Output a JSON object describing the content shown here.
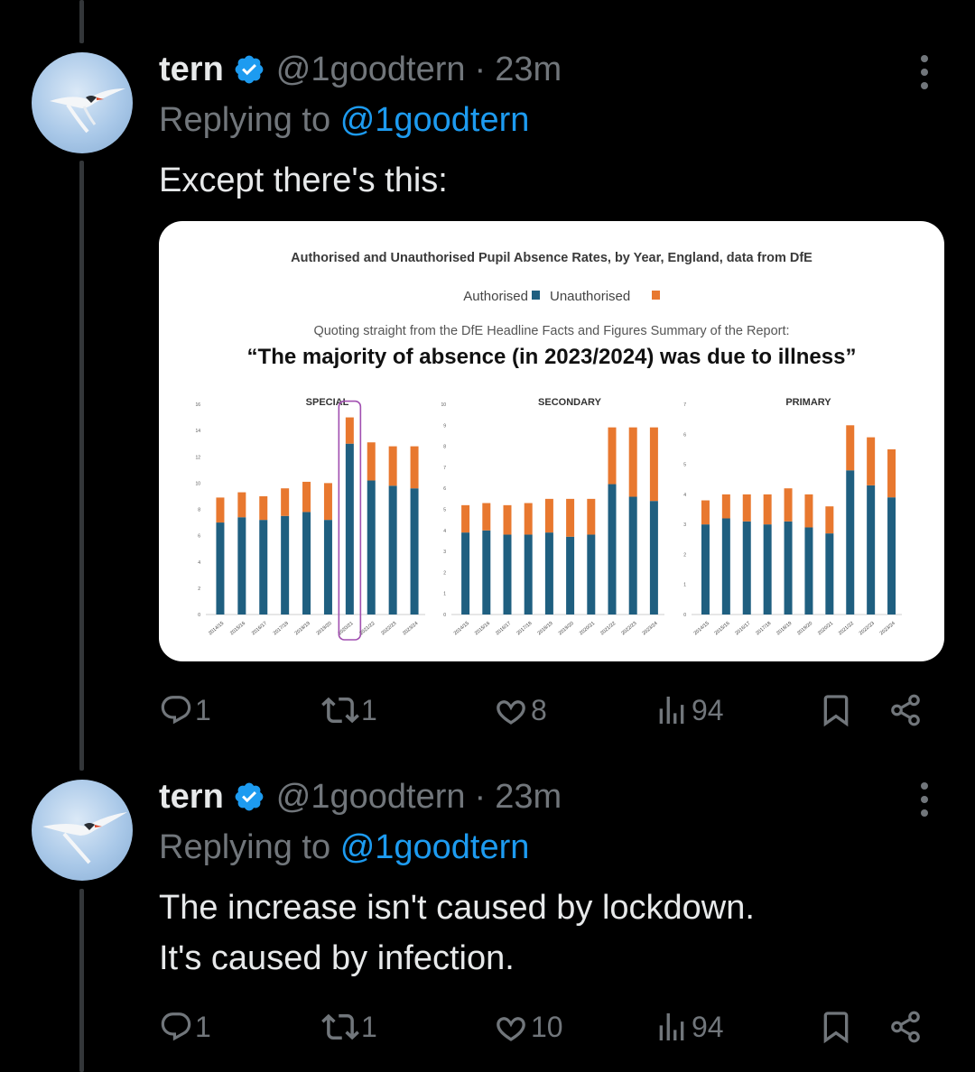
{
  "tweets": [
    {
      "name": "tern",
      "handle": "@1goodtern",
      "time": "23m",
      "replying_prefix": "Replying to",
      "replying_to": "@1goodtern",
      "text_lines": [
        "Except there's this:"
      ],
      "stats": {
        "replies": "1",
        "reposts": "1",
        "likes": "8",
        "views": "94"
      },
      "media": {
        "title": "Authorised and Unauthorised Pupil Absence Rates, by Year, England, data from DfE",
        "legend_authorised": "Authorised",
        "legend_unauthorised": "Unauthorised",
        "quote_intro": "Quoting straight from the DfE Headline Facts and Figures Summary of the Report:",
        "quote": "“The majority of absence (in 2023/2024) was due to illness”"
      }
    },
    {
      "name": "tern",
      "handle": "@1goodtern",
      "time": "23m",
      "replying_prefix": "Replying to",
      "replying_to": "@1goodtern",
      "text_lines": [
        "The increase isn't caused by lockdown.",
        "It's caused by infection."
      ],
      "stats": {
        "replies": "1",
        "reposts": "1",
        "likes": "10",
        "views": "94"
      }
    }
  ],
  "colors": {
    "authorised": "#1f5f80",
    "unauthorised": "#e8782f",
    "highlight": "#a14fb0",
    "mention": "#1d9bf0",
    "verified": "#1d9bf0"
  },
  "chart_data": [
    {
      "type": "bar",
      "title": "SPECIAL",
      "categories": [
        "2014/15",
        "2015/16",
        "2016/17",
        "2017/18",
        "2018/19",
        "2019/20",
        "2020/21",
        "2021/22",
        "2022/23",
        "2023/24"
      ],
      "series": [
        {
          "name": "Authorised",
          "values": [
            7.0,
            7.4,
            7.2,
            7.5,
            7.8,
            7.2,
            13.0,
            10.2,
            9.8,
            9.6
          ]
        },
        {
          "name": "Unauthorised",
          "values": [
            1.9,
            1.9,
            1.8,
            2.1,
            2.3,
            2.8,
            2.0,
            2.9,
            3.0,
            3.2
          ]
        }
      ],
      "ylim": [
        0,
        16
      ],
      "yticks": [
        0,
        2,
        4,
        6,
        8,
        10,
        12,
        14,
        16
      ],
      "highlight_category": "2020/21",
      "stacked": true
    },
    {
      "type": "bar",
      "title": "SECONDARY",
      "categories": [
        "2014/15",
        "2015/16",
        "2016/17",
        "2017/18",
        "2018/19",
        "2019/20",
        "2020/21",
        "2021/22",
        "2022/23",
        "2023/24"
      ],
      "series": [
        {
          "name": "Authorised",
          "values": [
            3.9,
            4.0,
            3.8,
            3.8,
            3.9,
            3.7,
            3.8,
            6.2,
            5.6,
            5.4
          ]
        },
        {
          "name": "Unauthorised",
          "values": [
            1.3,
            1.3,
            1.4,
            1.5,
            1.6,
            1.8,
            1.7,
            2.7,
            3.3,
            3.5
          ]
        }
      ],
      "ylim": [
        0,
        10
      ],
      "yticks": [
        0,
        1,
        2,
        3,
        4,
        5,
        6,
        7,
        8,
        9,
        10
      ],
      "stacked": true
    },
    {
      "type": "bar",
      "title": "PRIMARY",
      "categories": [
        "2014/15",
        "2015/16",
        "2016/17",
        "2017/18",
        "2018/19",
        "2019/20",
        "2020/21",
        "2021/22",
        "2022/23",
        "2023/24"
      ],
      "series": [
        {
          "name": "Authorised",
          "values": [
            3.0,
            3.2,
            3.1,
            3.0,
            3.1,
            2.9,
            2.7,
            4.8,
            4.3,
            3.9
          ]
        },
        {
          "name": "Unauthorised",
          "values": [
            0.8,
            0.8,
            0.9,
            1.0,
            1.1,
            1.1,
            0.9,
            1.5,
            1.6,
            1.6
          ]
        }
      ],
      "ylim": [
        0,
        7
      ],
      "yticks": [
        0,
        1,
        2,
        3,
        4,
        5,
        6,
        7
      ],
      "stacked": true
    }
  ]
}
